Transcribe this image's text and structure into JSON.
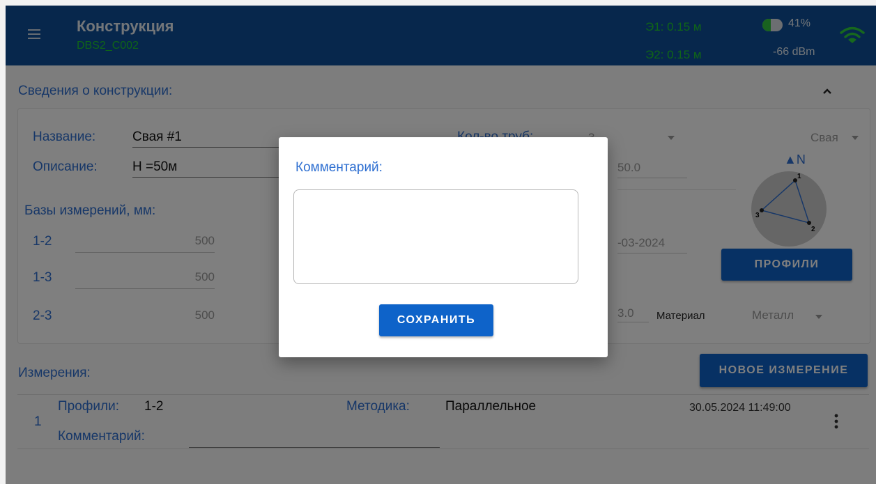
{
  "topbar": {
    "title": "Конструкция",
    "subtitle": "DBS2_C002",
    "e1": "Э1: 0.15 м",
    "e2": "Э2: 0.15 м",
    "battery_percent": "41%",
    "battery_level": 0.41,
    "signal": "-66 dBm"
  },
  "info": {
    "section_title": "Сведения о конструкции:",
    "name_label": "Название:",
    "name_value": "Свая #1",
    "desc_label": "Описание:",
    "desc_value": "Н =50м",
    "pipes_label": "Кол-во труб:",
    "pipes_value": "3",
    "type_value": "Свая",
    "length_value": "50.0",
    "north_label": "▲N",
    "bases_title": "Базы измерений, мм:",
    "bases": [
      {
        "label": "1-2",
        "value": "500"
      },
      {
        "label": "1-3",
        "value": "500"
      },
      {
        "label": "2-3",
        "value": "500"
      }
    ],
    "date_partial": "-03-2024",
    "num_partial": "3.0",
    "material_label": "Материал",
    "material_value": "Металл",
    "profiles_button": "ПРОФИЛИ",
    "diagram_points": [
      "1",
      "2",
      "3"
    ]
  },
  "measurements": {
    "section_title": "Измерения:",
    "new_button": "НОВОЕ ИЗМЕРЕНИЕ",
    "row": {
      "index": "1",
      "profiles_label": "Профили:",
      "profiles_value": "1-2",
      "method_label": "Методика:",
      "method_value": "Параллельное",
      "comment_label": "Комментарий:",
      "timestamp": "30.05.2024 11:49:00"
    }
  },
  "dialog": {
    "title": "Комментарий:",
    "input_value": "",
    "save_button": "СОХРАНИТЬ"
  },
  "colors": {
    "topbar": "#0e4f99",
    "accent": "#2e6fd1",
    "button": "#0e63c9",
    "status_green": "#1ecb2e"
  }
}
